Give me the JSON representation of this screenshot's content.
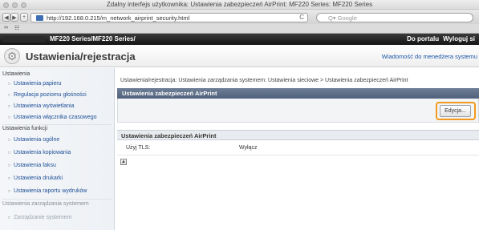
{
  "window": {
    "title": "Zdalny interfejs użytkownika: Ustawienia zabezpieczeń AirPrint: MF220 Series: MF220 Series"
  },
  "toolbar": {
    "back_label": "◀",
    "forward_label": "▶",
    "new_tab_label": "+",
    "url": "http://192.168.0.215/m_network_airprint_security.html",
    "reload_icon": "C",
    "search_placeholder": "Q▾ Google"
  },
  "bookmarks": {
    "icons": [
      "reading-list-icon",
      "bookmarks-grid-icon"
    ],
    "glyphs": [
      "∞",
      "☷"
    ]
  },
  "header": {
    "model": "MF220 Series/MF220 Series/",
    "links": [
      "Do portalu",
      "Wyloguj si"
    ],
    "page_title": "Ustawienia/rejestracja",
    "admin_message": "Wiadomość do menedżera systemu"
  },
  "sidebar": {
    "section1": "Ustawienia",
    "items1": [
      "Ustawienia papieru",
      "Regulacja poziomu głośności",
      "Ustawienia wyświetlania",
      "Ustawienia włącznika czasowego"
    ],
    "section2": "Ustawienia funkcji",
    "items2": [
      "Ustawienia ogólne",
      "Ustawienia kopiowania",
      "Ustawienia faksu",
      "Ustawienia drukarki",
      "Ustawienia raportu wydruków"
    ],
    "section3": "Ustawienia zarządzania systemem",
    "items3": [
      "Zarządzanie systemem"
    ]
  },
  "main": {
    "breadcrumb": "Ustawienia/rejestracja: Ustawienia zarządzania systemem: Ustawienia sieciowe > Ustawienia zabezpieczeń AirPrint",
    "panel_title": "Ustawienia zabezpieczeń AirPrint",
    "edit_label": "Edycja...",
    "section_title": "Ustawienia zabezpieczeń AirPrint",
    "row_label": "Użyj TLS:",
    "row_value": "Wyłącz",
    "top_label": "▲"
  },
  "colors": {
    "accent": "#f29a1b",
    "panel_header": "#5a6b86",
    "link": "#1d4f96"
  }
}
